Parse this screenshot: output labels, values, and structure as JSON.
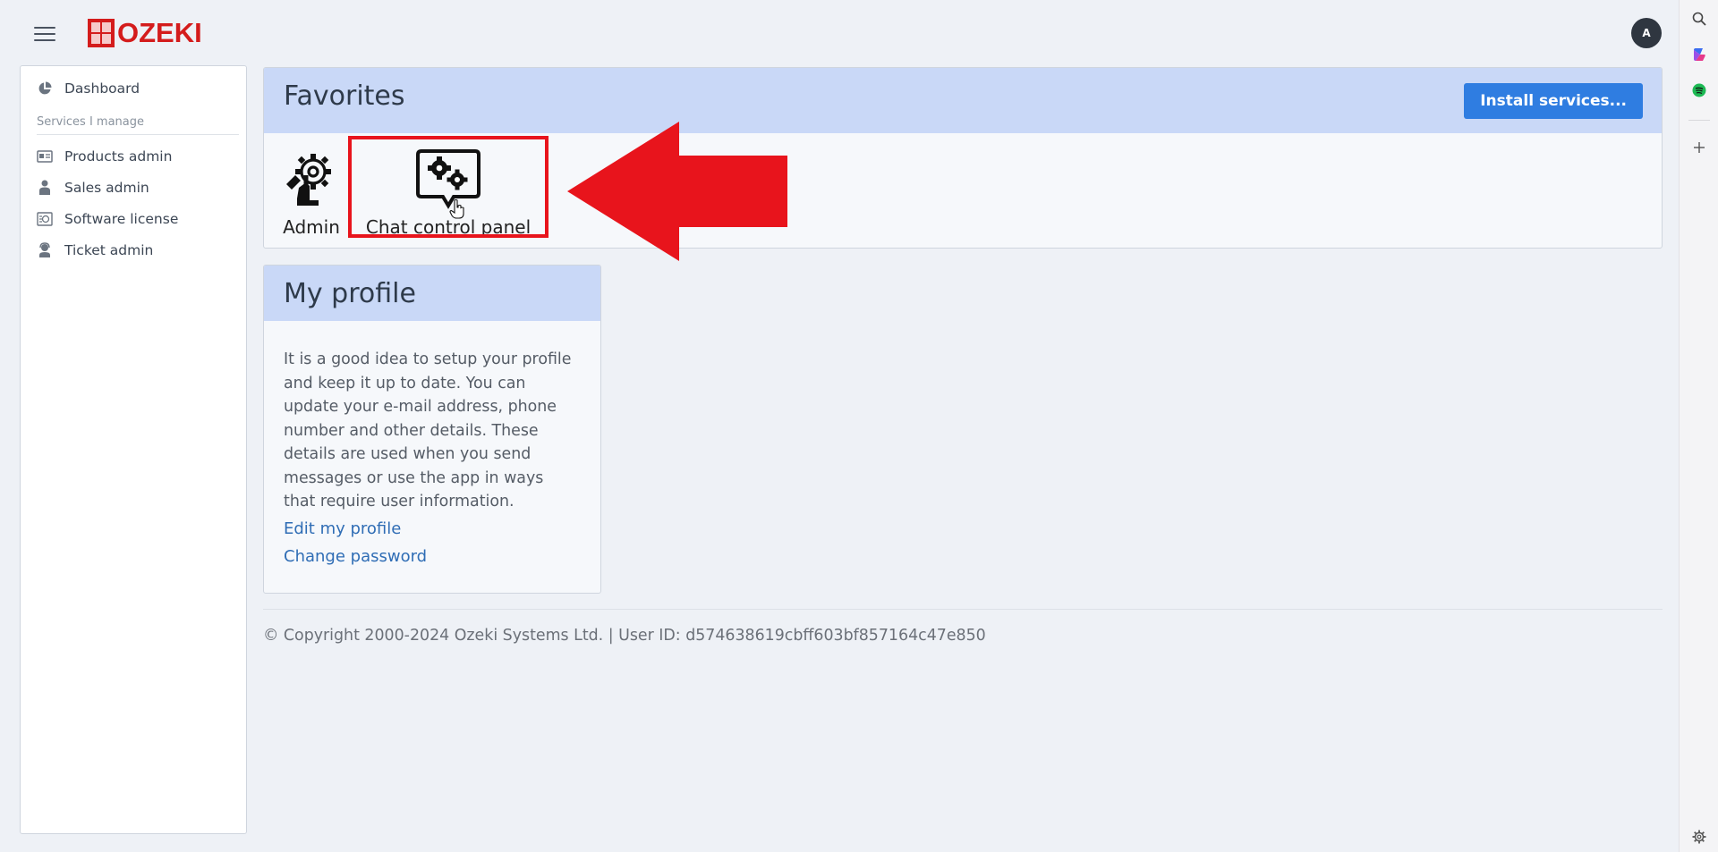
{
  "header": {
    "logo_text": "OZEKI",
    "avatar_initial": "A"
  },
  "sidebar": {
    "dashboard": "Dashboard",
    "section_heading": "Services I manage",
    "items": [
      {
        "label": "Products admin",
        "icon": "products-icon"
      },
      {
        "label": "Sales admin",
        "icon": "person-icon"
      },
      {
        "label": "Software license",
        "icon": "license-icon"
      },
      {
        "label": "Ticket admin",
        "icon": "support-agent-icon"
      }
    ]
  },
  "favorites": {
    "title": "Favorites",
    "install_button": "Install services...",
    "items": [
      {
        "label": "Admin",
        "icon": "admin-gear-hand-icon"
      },
      {
        "label": "Chat control panel",
        "icon": "chat-gears-icon"
      }
    ]
  },
  "profile": {
    "title": "My profile",
    "description": "It is a good idea to setup your profile and keep it up to date. You can update your e-mail address, phone number and other details. These details are used when you send messages or use the app in ways that require user information.",
    "edit_link": "Edit my profile",
    "password_link": "Change password"
  },
  "footer": {
    "text": "© Copyright 2000-2024 Ozeki Systems Ltd. | User ID: d574638619cbff603bf857164c47e850"
  },
  "colors": {
    "brand_red": "#d41c1c",
    "accent_blue": "#2f7de1",
    "card_header": "#c9d8f7",
    "highlight_red": "#e8141c",
    "link_blue": "#2f6db5"
  }
}
